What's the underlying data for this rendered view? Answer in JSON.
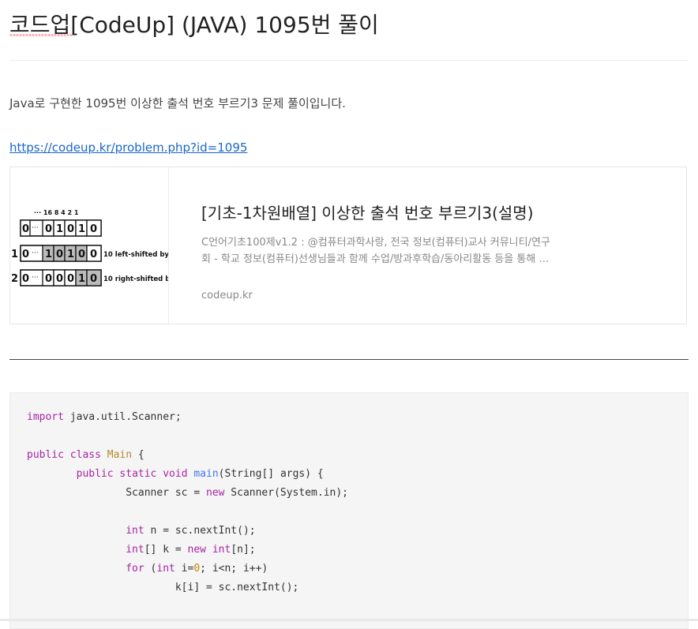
{
  "post": {
    "title": "코드업[CodeUp] (JAVA) 1095번 풀이",
    "intro": "Java로 구현한 1095번 이상한 출석 번호 부르기3 문제 풀이입니다.",
    "link_text": "https://codeup.kr/problem.php?id=1095"
  },
  "link_card": {
    "title": "[기초-1차원배열] 이상한 출석 번호 부르기3(설명)",
    "description_line1": "C언어기초100제v1.2 : @컴퓨터과학사랑, 전국 정보(컴퓨터)교사 커뮤니티/연구",
    "description_line2": "회 - 학교 정보(컴퓨터)선생님들과 함께 수업/방과후학습/동아리활동 등을 통해 …",
    "domain": "codeup.kr",
    "thumb": {
      "top_labels": "··· 16 8 4 2 1",
      "row0_bits": [
        "0",
        "···",
        "0",
        "1",
        "0",
        "1",
        "0"
      ],
      "row1_prefix": "1",
      "row1_bits": [
        "0",
        "···",
        "1",
        "0",
        "1",
        "0",
        "0"
      ],
      "row1_label": "10 left-shifted by",
      "row2_prefix": "2",
      "row2_bits": [
        "0",
        "···",
        "0",
        "0",
        "0",
        "1",
        "0"
      ],
      "row2_label": "10 right-shifted b"
    }
  },
  "code": {
    "language": "java",
    "lines": [
      "import java.util.Scanner;",
      "",
      "public class Main {",
      "        public static void main(String[] args) {",
      "                Scanner sc = new Scanner(System.in);",
      "",
      "                int n = sc.nextInt();",
      "                int[] k = new int[n];",
      "                for (int i=0; i<n; i++)",
      "                        k[i] = sc.nextInt();"
    ]
  },
  "colors": {
    "link": "#1a66c9",
    "keyword": "#a626a4",
    "class_name": "#b68a2a",
    "function": "#4078f2",
    "number": "#c18401",
    "code_bg": "#f5f5f5"
  }
}
